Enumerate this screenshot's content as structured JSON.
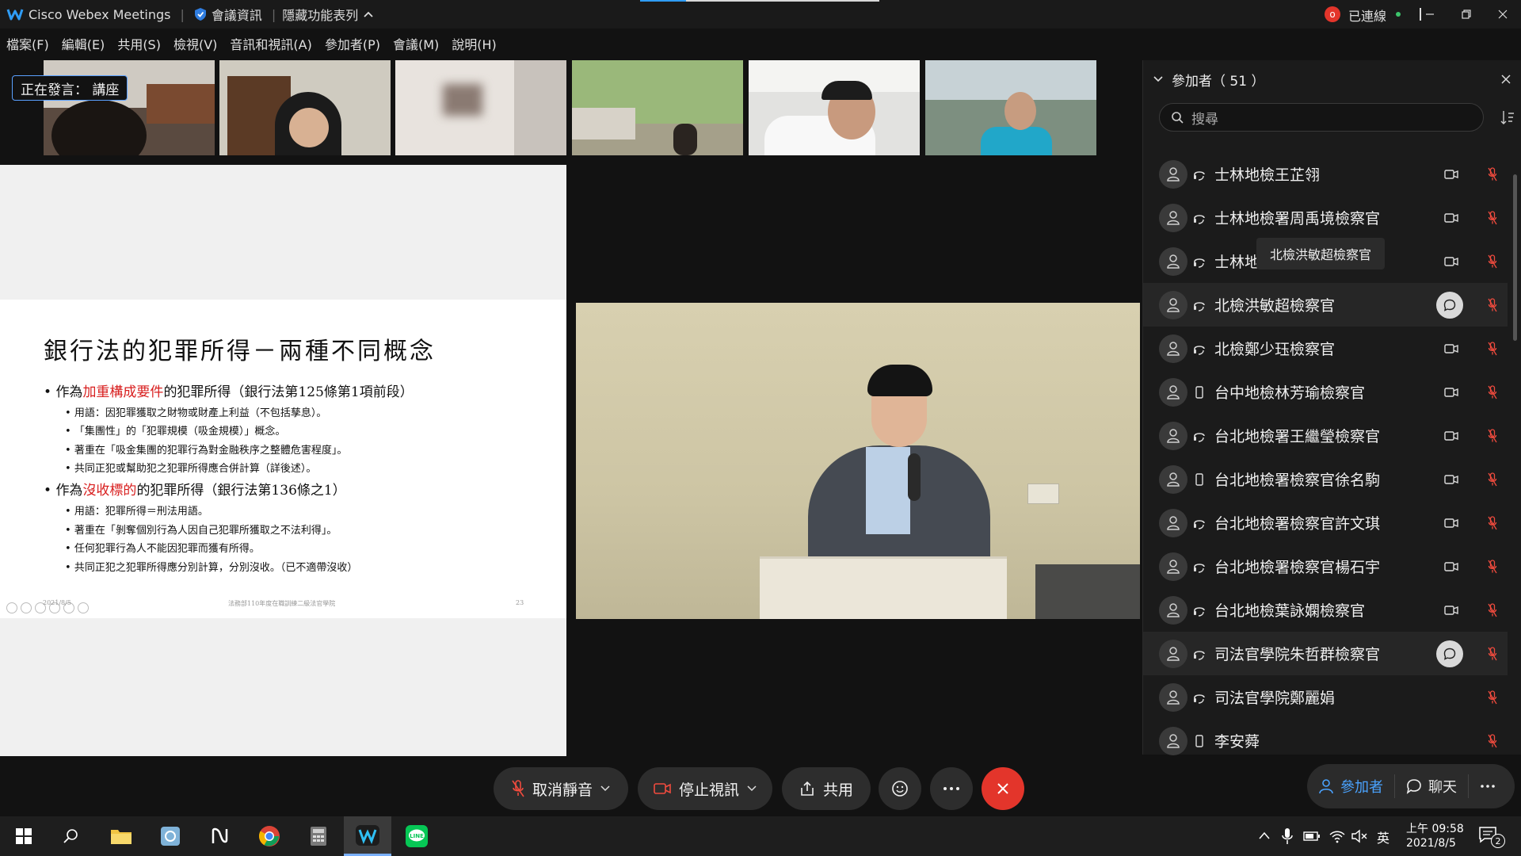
{
  "window": {
    "app_title": "Cisco Webex Meetings",
    "meeting_info": "會議資訊",
    "hide_menu": "隱藏功能表列",
    "connected": "已連線",
    "connected_badge": "o"
  },
  "menu": [
    "檔案(F)",
    "編輯(E)",
    "共用(S)",
    "檢視(V)",
    "音訊和視訊(A)",
    "參加者(P)",
    "會議(M)",
    "說明(H)"
  ],
  "speaking_label": "正在發言： 講座",
  "slide": {
    "title": "銀行法的犯罪所得－兩種不同概念",
    "bullet1_prefix": "作為",
    "bullet1_red": "加重構成要件",
    "bullet1_suffix": "的犯罪所得（銀行法第125條第1項前段）",
    "sub1": [
      "用語：因犯罪獲取之財物或財產上利益（不包括孳息）。",
      "「集團性」的「犯罪規模（吸金規模）」概念。",
      "著重在「吸金集團的犯罪行為對金融秩序之整體危害程度」。",
      "共同正犯或幫助犯之犯罪所得應合併計算（詳後述）。"
    ],
    "bullet2_prefix": "作為",
    "bullet2_red": "沒收標的",
    "bullet2_suffix": "的犯罪所得（銀行法第136條之1）",
    "sub2": [
      "用語：犯罪所得＝刑法用語。",
      "著重在「剝奪個別行為人因自己犯罪所獲取之不法利得」。",
      "任何犯罪行為人不能因犯罪而獲有所得。",
      "共同正犯之犯罪所得應分別計算，分別沒收。（已不適帶沒收）"
    ],
    "footer_date": "2021/8/5",
    "footer_center": "法務部110年度在職訓練二級法官學院",
    "footer_page": "23"
  },
  "panel": {
    "title": "參加者（ 51 ）",
    "search_placeholder": "搜尋",
    "tooltip": "北檢洪敏超檢察官",
    "participants": [
      {
        "name": "士林地檢王芷翎",
        "device": "headset",
        "state": "cam"
      },
      {
        "name": "士林地檢署周禹境檢察官",
        "device": "headset",
        "state": "cam"
      },
      {
        "name": "士林地",
        "device": "headset",
        "state": "cam"
      },
      {
        "name": "北檢洪敏超檢察官",
        "device": "headset",
        "state": "chat"
      },
      {
        "name": "北檢鄭少珏檢察官",
        "device": "headset",
        "state": "cam"
      },
      {
        "name": "台中地檢林芳瑜檢察官",
        "device": "phone",
        "state": "cam"
      },
      {
        "name": "台北地檢署王繼瑩檢察官",
        "device": "headset",
        "state": "cam"
      },
      {
        "name": "台北地檢署檢察官徐名駒",
        "device": "phone",
        "state": "cam"
      },
      {
        "name": "台北地檢署檢察官許文琪",
        "device": "headset",
        "state": "cam"
      },
      {
        "name": "台北地檢署檢察官楊石宇",
        "device": "headset",
        "state": "cam"
      },
      {
        "name": "台北地檢葉詠嫻檢察官",
        "device": "headset",
        "state": "cam"
      },
      {
        "name": "司法官學院朱哲群檢察官",
        "device": "headset",
        "state": "chat"
      },
      {
        "name": "司法官學院鄭麗娟",
        "device": "headset",
        "state": "none"
      },
      {
        "name": "李安蕣",
        "device": "phone",
        "state": "none"
      }
    ]
  },
  "controls": {
    "unmute": "取消靜音",
    "stop_video": "停止視訊",
    "share": "共用",
    "participants_tab": "參加者",
    "chat_tab": "聊天"
  },
  "taskbar": {
    "ime": "英",
    "time": "上午 09:58",
    "date": "2021/8/5",
    "notifications": "2"
  },
  "colors": {
    "accent_blue": "#4aa3ff",
    "end_red": "#e3352b",
    "mic_red": "#f04b3e",
    "slide_red": "#d81e1e"
  }
}
